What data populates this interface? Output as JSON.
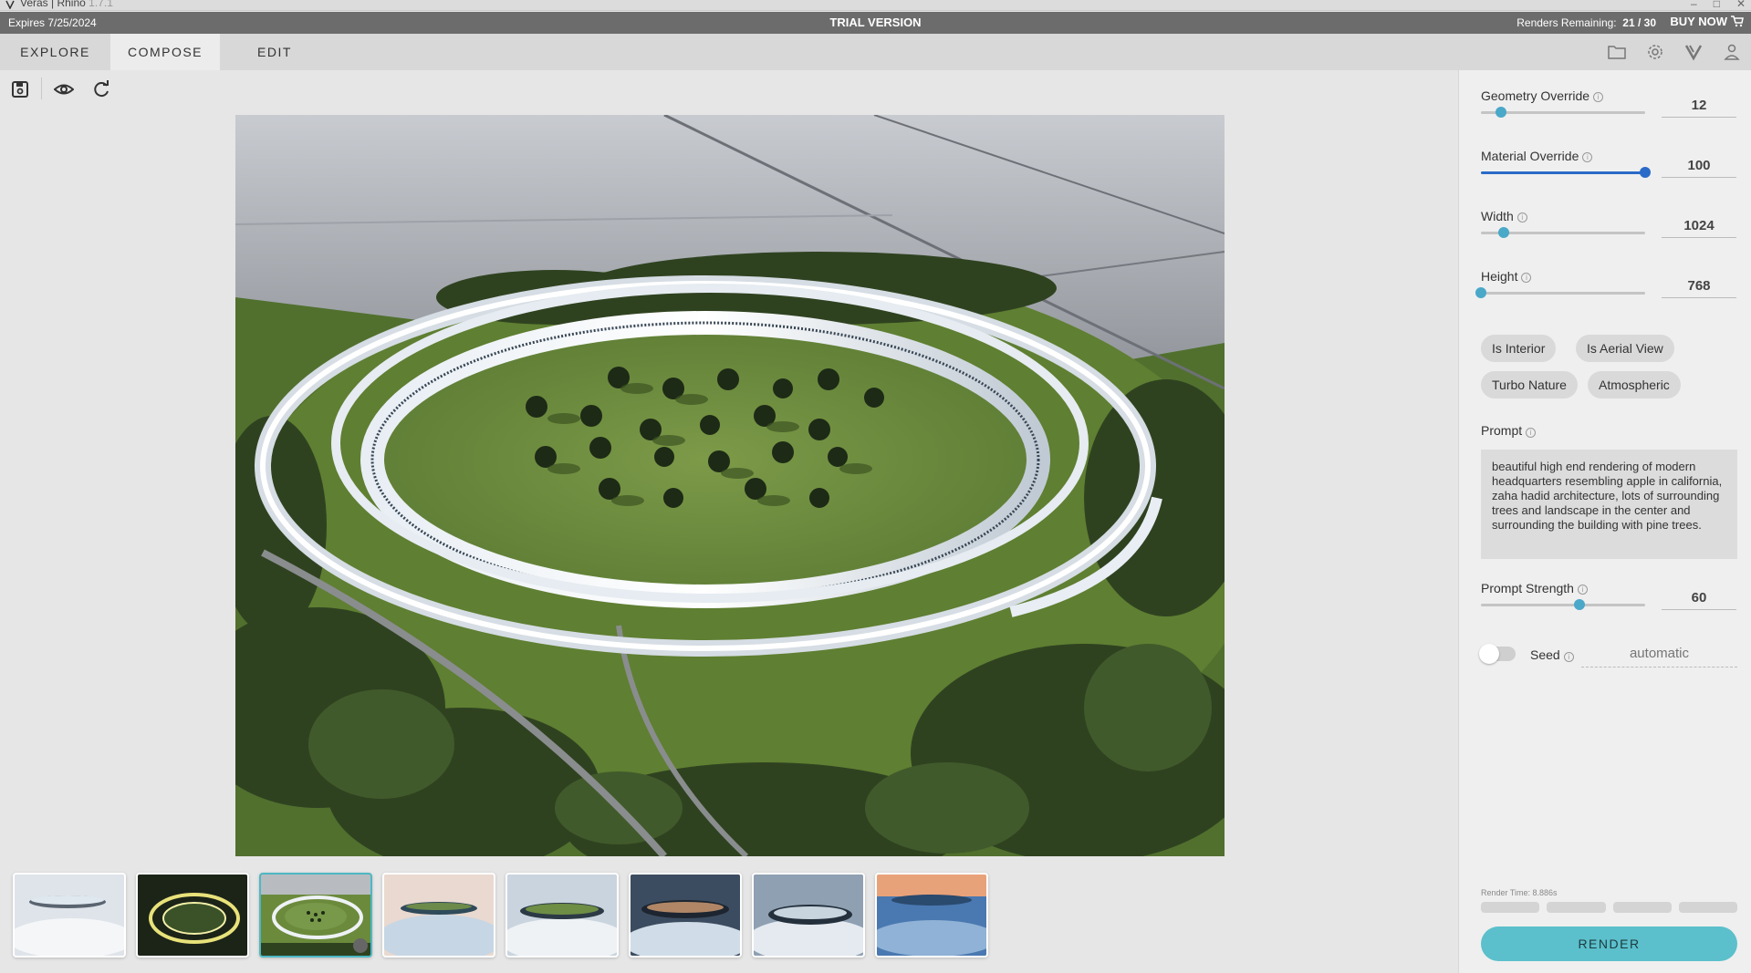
{
  "os_titlebar": {
    "title": "Veras | Rhino",
    "version": "1.7.1",
    "minimize": "–",
    "maximize": "□",
    "close": "✕"
  },
  "trial_bar": {
    "expires": "Expires 7/25/2024",
    "banner": "TRIAL VERSION",
    "renders_label": "Renders Remaining:",
    "renders_value": "21 / 30",
    "buy_now": "BUY NOW"
  },
  "tabs": [
    {
      "label": "EXPLORE",
      "active": false
    },
    {
      "label": "COMPOSE",
      "active": true
    },
    {
      "label": "EDIT",
      "active": false
    }
  ],
  "top_icons": [
    "folder-icon",
    "gear-icon",
    "veras-logo-icon",
    "user-icon"
  ],
  "toolbar": {
    "icons": [
      "save-icon",
      "eye-icon",
      "refresh-icon"
    ]
  },
  "params": {
    "geometry_override": {
      "label": "Geometry Override",
      "value": "12",
      "fraction": 0.12
    },
    "material_override": {
      "label": "Material Override",
      "value": "100",
      "fraction": 1.0
    },
    "width": {
      "label": "Width",
      "value": "1024",
      "fraction": 0.14
    },
    "height": {
      "label": "Height",
      "value": "768",
      "fraction": 0.0
    },
    "prompt_strength": {
      "label": "Prompt Strength",
      "value": "60",
      "fraction": 0.6
    }
  },
  "chips": [
    "Is Interior",
    "Is Aerial View",
    "Turbo Nature",
    "Atmospheric"
  ],
  "prompt": {
    "label": "Prompt",
    "text": "beautiful high end rendering of modern headquarters resembling apple in california, zaha hadid architecture, lots of surrounding trees and landscape in the center and surrounding the building with pine trees."
  },
  "seed": {
    "label": "Seed",
    "placeholder": "automatic",
    "enabled": false
  },
  "render_time": "Render Time: 8.886s",
  "render_button": "RENDER",
  "colors": {
    "accent": "#5bc0cb",
    "slider_blue": "#2a6ac8",
    "trial_bar": "#6c6c6c"
  },
  "thumbnails": [
    {
      "name": "thumb-1",
      "style": "clouds-grey",
      "selected": false
    },
    {
      "name": "thumb-2",
      "style": "night-glow",
      "selected": false
    },
    {
      "name": "thumb-3",
      "style": "green-ring",
      "selected": true
    },
    {
      "name": "thumb-4",
      "style": "clouds-sunrise",
      "selected": false
    },
    {
      "name": "thumb-5",
      "style": "clouds-green",
      "selected": false
    },
    {
      "name": "thumb-6",
      "style": "clouds-dark",
      "selected": false
    },
    {
      "name": "thumb-7",
      "style": "clouds-water",
      "selected": false
    },
    {
      "name": "thumb-8",
      "style": "sunset-clouds",
      "selected": false
    }
  ]
}
